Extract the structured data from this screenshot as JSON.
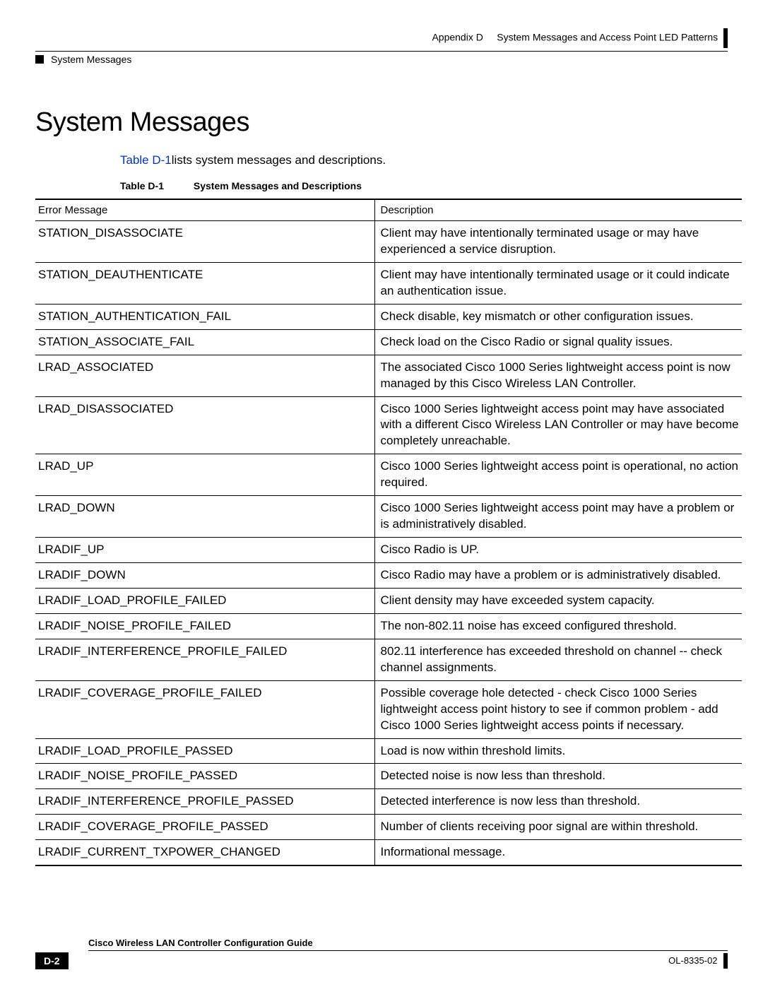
{
  "header": {
    "appendix": "Appendix D",
    "appendix_title": "System Messages and Access Point LED Patterns",
    "section": "System Messages"
  },
  "heading": "System Messages",
  "intro": {
    "link": "Table D-1",
    "text": "lists system messages and descriptions."
  },
  "table_caption": {
    "label": "Table D-1",
    "title": "System Messages and Descriptions"
  },
  "table": {
    "headers": {
      "error": "Error Message",
      "description": "Description"
    },
    "rows": [
      {
        "error": "STATION_DISASSOCIATE",
        "description": "Client may have intentionally terminated usage or may have experienced a service disruption."
      },
      {
        "error": "STATION_DEAUTHENTICATE",
        "description": "Client may have intentionally terminated usage or it could indicate an authentication issue."
      },
      {
        "error": "STATION_AUTHENTICATION_FAIL",
        "description": "Check disable, key mismatch or other configuration issues."
      },
      {
        "error": "STATION_ASSOCIATE_FAIL",
        "description": "Check load on the Cisco Radio or signal quality issues."
      },
      {
        "error": "LRAD_ASSOCIATED",
        "description": "The associated Cisco 1000 Series lightweight access point is now managed by this Cisco Wireless LAN Controller."
      },
      {
        "error": "LRAD_DISASSOCIATED",
        "description": "Cisco 1000 Series lightweight access point may have associated with a different Cisco Wireless LAN Controller or may have become completely unreachable."
      },
      {
        "error": "LRAD_UP",
        "description": "Cisco 1000 Series lightweight access point is operational, no action required."
      },
      {
        "error": "LRAD_DOWN",
        "description": "Cisco 1000 Series lightweight access point may have a problem or is administratively disabled."
      },
      {
        "error": "LRADIF_UP",
        "description": "Cisco Radio is UP."
      },
      {
        "error": "LRADIF_DOWN",
        "description": "Cisco Radio may have a problem or is administratively disabled."
      },
      {
        "error": "LRADIF_LOAD_PROFILE_FAILED",
        "description": "Client density may have exceeded system capacity."
      },
      {
        "error": "LRADIF_NOISE_PROFILE_FAILED",
        "description": "The non-802.11 noise has exceed configured threshold."
      },
      {
        "error": "LRADIF_INTERFERENCE_PROFILE_FAILED",
        "description": "802.11 interference has exceeded threshold on channel -- check channel assignments."
      },
      {
        "error": "LRADIF_COVERAGE_PROFILE_FAILED",
        "description": "Possible coverage hole detected - check Cisco 1000 Series lightweight access point history to see if common problem - add Cisco 1000 Series lightweight access points if necessary."
      },
      {
        "error": "LRADIF_LOAD_PROFILE_PASSED",
        "description": "Load is now within threshold limits."
      },
      {
        "error": "LRADIF_NOISE_PROFILE_PASSED",
        "description": "Detected noise is now less than threshold."
      },
      {
        "error": "LRADIF_INTERFERENCE_PROFILE_PASSED",
        "description": "Detected interference is now less than threshold."
      },
      {
        "error": "LRADIF_COVERAGE_PROFILE_PASSED",
        "description": "Number of clients receiving poor signal are within threshold."
      },
      {
        "error": "LRADIF_CURRENT_TXPOWER_CHANGED",
        "description": "Informational message."
      }
    ]
  },
  "footer": {
    "guide_title": "Cisco Wireless LAN Controller Configuration Guide",
    "page_number": "D-2",
    "doc_id": "OL-8335-02"
  }
}
